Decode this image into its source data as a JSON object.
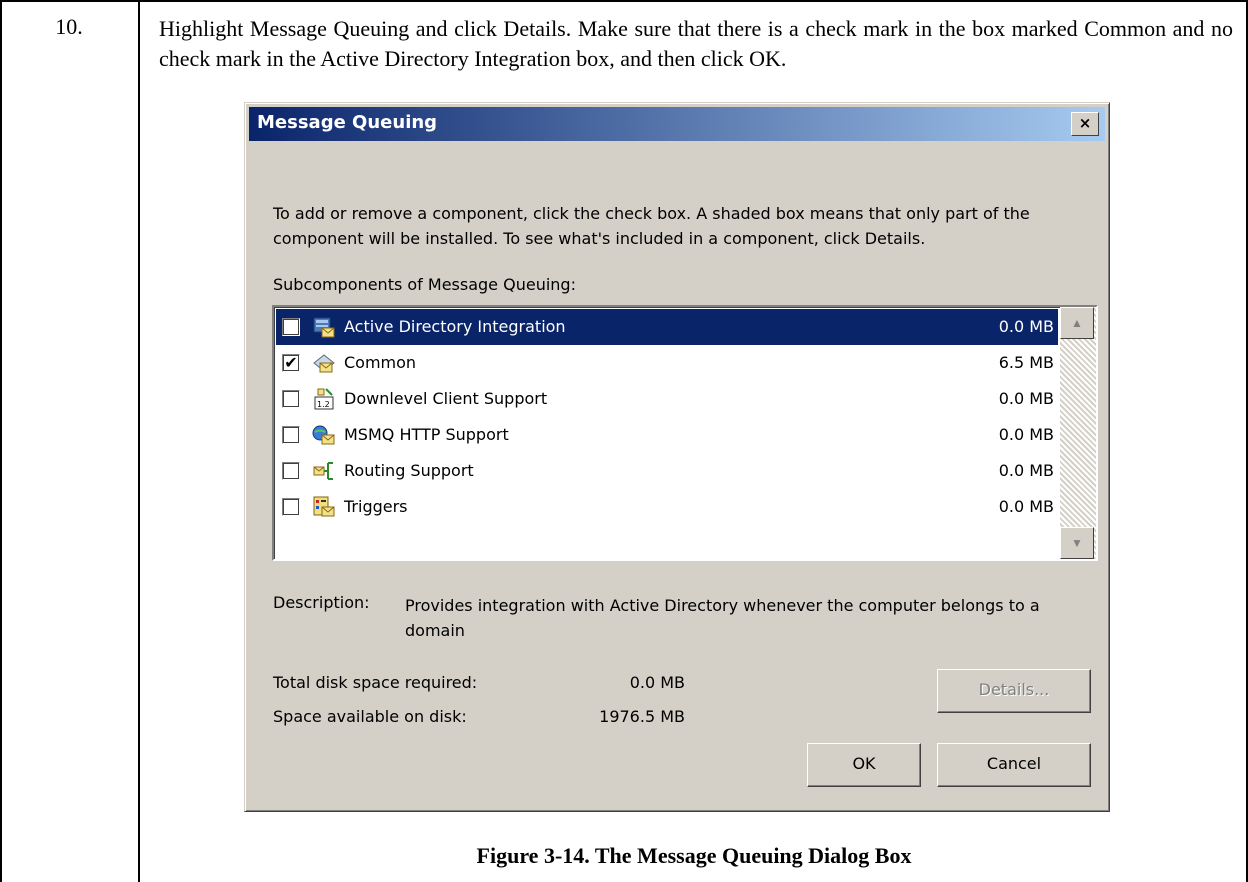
{
  "step": {
    "number": "10.",
    "instruction": "Highlight Message Queuing and click Details.  Make sure that there is a check mark in the box marked Common and no check mark in the Active Directory Integration box, and then click OK.",
    "caption": "Figure 3-14.  The Message Queuing Dialog Box"
  },
  "dialog": {
    "title": "Message Queuing",
    "close_label": "×",
    "intro": "To add or remove a component, click the check box. A shaded box means that only part of the component will be installed. To see what's included in a component, click Details.",
    "subcomponents_label": "Subcomponents of Message Queuing:",
    "items": [
      {
        "label": "Active Directory Integration",
        "size": "0.0 MB",
        "checked": false,
        "selected": true,
        "icon": "active-directory-icon"
      },
      {
        "label": "Common",
        "size": "6.5 MB",
        "checked": true,
        "selected": false,
        "icon": "common-mail-icon"
      },
      {
        "label": "Downlevel Client Support",
        "size": "0.0 MB",
        "checked": false,
        "selected": false,
        "icon": "downlevel-client-icon"
      },
      {
        "label": "MSMQ HTTP Support",
        "size": "0.0 MB",
        "checked": false,
        "selected": false,
        "icon": "http-support-icon"
      },
      {
        "label": "Routing Support",
        "size": "0.0 MB",
        "checked": false,
        "selected": false,
        "icon": "routing-icon"
      },
      {
        "label": "Triggers",
        "size": "0.0 MB",
        "checked": false,
        "selected": false,
        "icon": "triggers-icon"
      }
    ],
    "description_label": "Description:",
    "description": "Provides integration with Active Directory whenever the computer belongs to a domain",
    "total_label": "Total disk space required:",
    "total_value": "0.0 MB",
    "available_label": "Space available on disk:",
    "available_value": "1976.5 MB",
    "details_label": "Details...",
    "ok_label": "OK",
    "cancel_label": "Cancel"
  },
  "colors": {
    "titlebar_start": "#0a246a",
    "titlebar_end": "#a6caf0",
    "selection": "#0a246a",
    "dialog_face": "#d4d0c8"
  }
}
